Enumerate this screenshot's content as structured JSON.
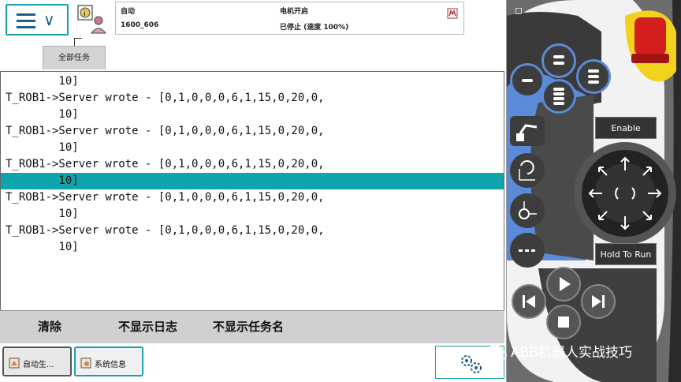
{
  "status": {
    "mode": "自动",
    "controller": "1600_606",
    "motor": "电机开启",
    "state": "已停止 (速度 100%)"
  },
  "task_tab": "全部任务",
  "log": {
    "lines": [
      "        10]",
      "T_ROB1->Server wrote - [0,1,0,0,0,6,1,15,0,20,0,",
      "        10]",
      "T_ROB1->Server wrote - [0,1,0,0,0,6,1,15,0,20,0,",
      "        10]",
      "T_ROB1->Server wrote - [0,1,0,0,0,6,1,15,0,20,0,",
      "        10]",
      "T_ROB1->Server wrote - [0,1,0,0,0,6,1,15,0,20,0,",
      "        10]",
      "T_ROB1->Server wrote - [0,1,0,0,0,6,1,15,0,20,0,",
      "        10]"
    ],
    "highlight_index": 6,
    "highlight_color": "#10a4ac"
  },
  "commands": {
    "clear": "清除",
    "hide_log": "不显示日志",
    "hide_taskname": "不显示任务名"
  },
  "taskbar": {
    "auto": "自动生...",
    "sysinfo": "系统信息"
  },
  "window_controls": {
    "restore": "◻",
    "minimize": "–",
    "close": "✕"
  },
  "pendant": {
    "enable": "Enable",
    "hold_to_run": "Hold To Run"
  },
  "watermark": "ABB机器人实战技巧"
}
